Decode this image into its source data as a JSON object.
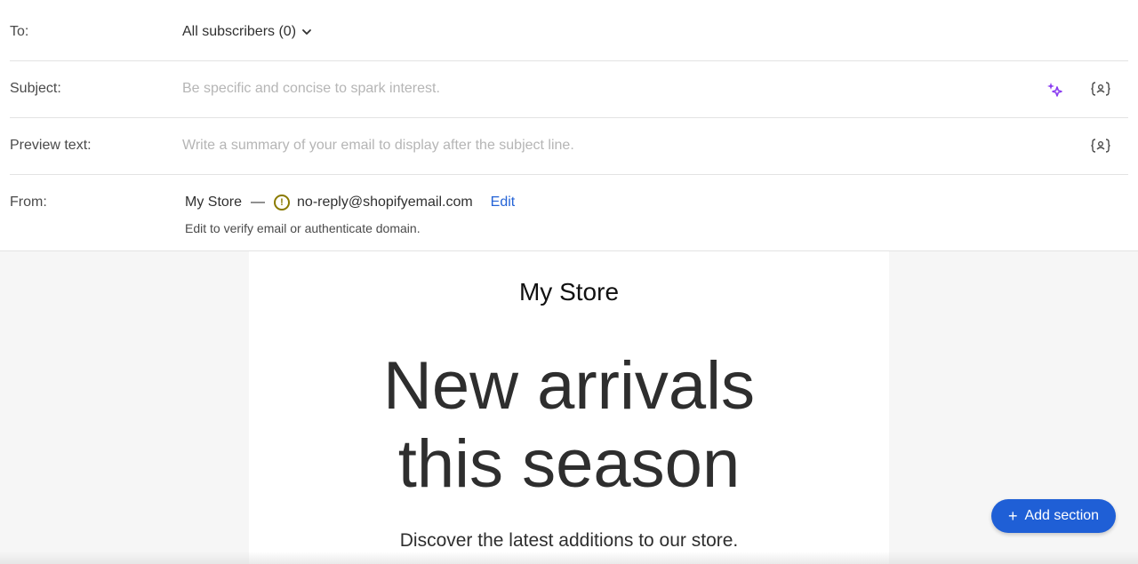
{
  "header": {
    "to": {
      "label": "To:",
      "value": "All subscribers (0)"
    },
    "subject": {
      "label": "Subject:",
      "placeholder": "Be specific and concise to spark interest."
    },
    "preview": {
      "label": "Preview text:",
      "placeholder": "Write a summary of your email to display after the subject line."
    },
    "from": {
      "label": "From:",
      "name": "My Store",
      "separator": "—",
      "email": "no-reply@shopifyemail.com",
      "edit_label": "Edit",
      "help": "Edit to verify email or authenticate domain."
    }
  },
  "email": {
    "store_name": "My Store",
    "headline_line1": "New arrivals",
    "headline_line2": "this season",
    "subline": "Discover the latest additions to our store."
  },
  "actions": {
    "add_section_label": "Add section"
  },
  "icons": {
    "ai": "sparkle-icon",
    "personalize": "personalize-variable-icon",
    "warning": "warning-circle-icon",
    "chevron": "chevron-down-icon"
  },
  "colors": {
    "accent": "#1f5fd6",
    "link": "#2463d6",
    "ai_purple": "#8a3cf0",
    "warning": "#8a7a00"
  }
}
